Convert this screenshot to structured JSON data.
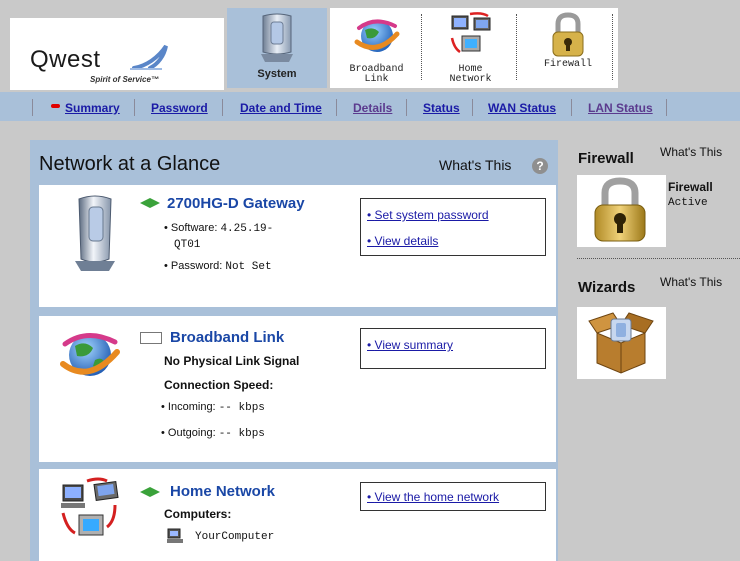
{
  "brand": {
    "logo_word": "Qwest",
    "tagline": "Spirit of Service™"
  },
  "nav_tabs": [
    {
      "id": "system",
      "label": "System",
      "active": true
    },
    {
      "id": "broadband",
      "label_line1": "Broadband",
      "label_line2": "Link"
    },
    {
      "id": "home",
      "label_line1": "Home",
      "label_line2": "Network"
    },
    {
      "id": "firewall",
      "label": "Firewall"
    }
  ],
  "subnav": [
    "Summary",
    "Password",
    "Date and Time",
    "Details",
    "Status",
    "WAN Status",
    "LAN Status"
  ],
  "main": {
    "title": "Network at a Glance",
    "whats_this": "What's This",
    "help_glyph": "?"
  },
  "gateway": {
    "title": "2700HG-D Gateway",
    "software_label": "Software:",
    "software_value": "4.25.19-",
    "software_value_cont": "QT01",
    "password_label": "Password:",
    "password_value": "Not Set",
    "links": [
      "Set system password",
      "View details"
    ]
  },
  "broadband": {
    "title": "Broadband Link",
    "signal": "No Physical Link Signal",
    "speed_label": "Connection Speed:",
    "incoming_label": "Incoming:",
    "incoming_value": "-- kbps",
    "outgoing_label": "Outgoing:",
    "outgoing_value": "-- kbps",
    "links": [
      "View summary"
    ]
  },
  "home_network": {
    "title": "Home Network",
    "computers_label": "Computers:",
    "computer_name": "YourComputer",
    "links": [
      "View the home network"
    ]
  },
  "side": {
    "firewall_heading": "Firewall",
    "firewall_whats": "What's This",
    "firewall_status_title": "Firewall",
    "firewall_status_value": "Active",
    "wizards_heading": "Wizards",
    "wizards_whats": "What's This"
  },
  "colors": {
    "panel_blue": "#a9c0d9",
    "link_blue": "#1a1aa6",
    "title_blue": "#1a47a6",
    "accent_green": "#3aa23a",
    "summary_marker": "#e00000"
  }
}
